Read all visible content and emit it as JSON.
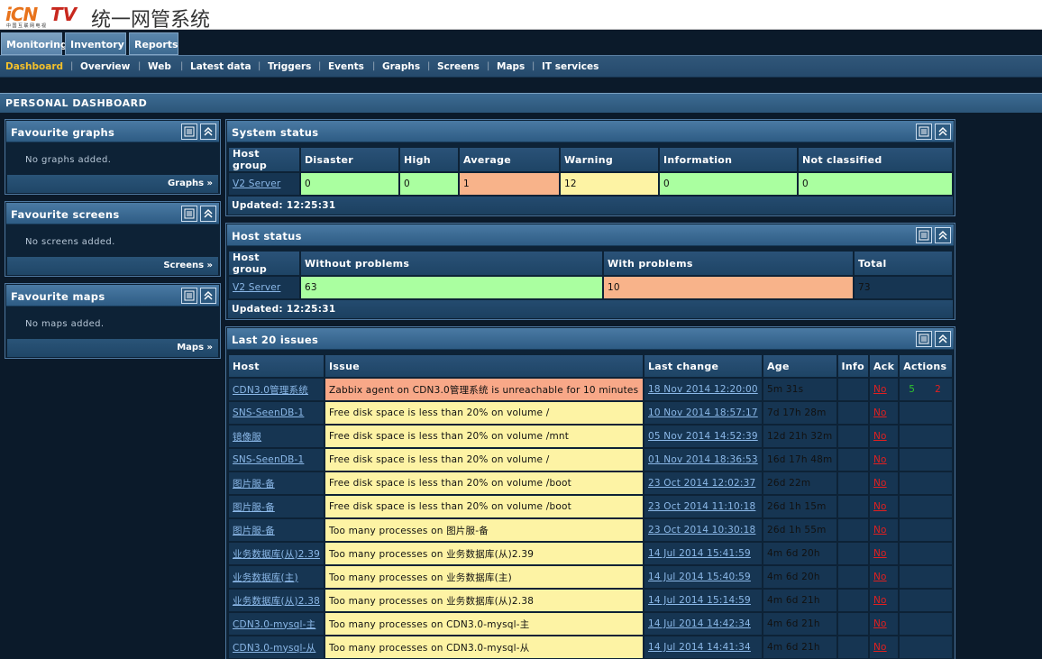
{
  "header": {
    "logo_text_icn": "iCN",
    "logo_text_tv": "TV",
    "logo_sub": "中国互联网电视",
    "system_title": "统一网管系统"
  },
  "main_tabs": [
    "Monitoring",
    "Inventory",
    "Reports"
  ],
  "subnav": [
    "Dashboard",
    "Overview",
    "Web",
    "Latest data",
    "Triggers",
    "Events",
    "Graphs",
    "Screens",
    "Maps",
    "IT services"
  ],
  "page_title": "PERSONAL DASHBOARD",
  "fav_graphs": {
    "title": "Favourite graphs",
    "empty": "No graphs added.",
    "link": "Graphs »"
  },
  "fav_screens": {
    "title": "Favourite screens",
    "empty": "No screens added.",
    "link": "Screens »"
  },
  "fav_maps": {
    "title": "Favourite maps",
    "empty": "No maps added.",
    "link": "Maps »"
  },
  "system_status": {
    "title": "System status",
    "headers": [
      "Host group",
      "Disaster",
      "High",
      "Average",
      "Warning",
      "Information",
      "Not classified"
    ],
    "row": [
      "V2 Server",
      "0",
      "0",
      "1",
      "12",
      "0",
      "0"
    ],
    "updated": "Updated: 12:25:31"
  },
  "host_status": {
    "title": "Host status",
    "headers": [
      "Host group",
      "Without problems",
      "With problems",
      "Total"
    ],
    "row": [
      "V2 Server",
      "63",
      "10",
      "73"
    ],
    "updated": "Updated: 12:25:31"
  },
  "issues": {
    "title": "Last 20 issues",
    "headers": [
      "Host",
      "Issue",
      "Last change",
      "Age",
      "Info",
      "Ack",
      "Actions"
    ],
    "rows": [
      [
        "CDN3.0管理系统",
        "Zabbix agent on CDN3.0管理系统 is unreachable for 10 minutes",
        "18 Nov 2014 12:20:00",
        "5m 31s",
        "No",
        "5",
        "2"
      ],
      [
        "SNS-SeenDB-1",
        "Free disk space is less than 20% on volume /",
        "10 Nov 2014 18:57:17",
        "7d 17h 28m",
        "No",
        "",
        ""
      ],
      [
        "镜像服",
        "Free disk space is less than 20% on volume /mnt",
        "05 Nov 2014 14:52:39",
        "12d 21h 32m",
        "No",
        "",
        ""
      ],
      [
        "SNS-SeenDB-1",
        "Free disk space is less than 20% on volume /",
        "01 Nov 2014 18:36:53",
        "16d 17h 48m",
        "No",
        "",
        ""
      ],
      [
        "图片服-备",
        "Free disk space is less than 20% on volume /boot",
        "23 Oct 2014 12:02:37",
        "26d 22m",
        "No",
        "",
        ""
      ],
      [
        "图片服-备",
        "Free disk space is less than 20% on volume /boot",
        "23 Oct 2014 11:10:18",
        "26d 1h 15m",
        "No",
        "",
        ""
      ],
      [
        "图片服-备",
        "Too many processes on 图片服-备",
        "23 Oct 2014 10:30:18",
        "26d 1h 55m",
        "No",
        "",
        ""
      ],
      [
        "业务数据库(从)2.39",
        "Too many processes on 业务数据库(从)2.39",
        "14 Jul 2014 15:41:59",
        "4m 6d 20h",
        "No",
        "",
        ""
      ],
      [
        "业务数据库(主)",
        "Too many processes on 业务数据库(主)",
        "14 Jul 2014 15:40:59",
        "4m 6d 20h",
        "No",
        "",
        ""
      ],
      [
        "业务数据库(从)2.38",
        "Too many processes on 业务数据库(从)2.38",
        "14 Jul 2014 15:14:59",
        "4m 6d 21h",
        "No",
        "",
        ""
      ],
      [
        "CDN3.0-mysql-主",
        "Too many processes on CDN3.0-mysql-主",
        "14 Jul 2014 14:42:34",
        "4m 6d 21h",
        "No",
        "",
        ""
      ],
      [
        "CDN3.0-mysql-从",
        "Too many processes on CDN3.0-mysql-从",
        "14 Jul 2014 14:41:34",
        "4m 6d 21h",
        "No",
        "",
        ""
      ]
    ]
  },
  "colors": {
    "ok": "#aaffa0",
    "average": "#f8b38a",
    "warning": "#fdf3a4",
    "accent": "#f3c02b"
  }
}
